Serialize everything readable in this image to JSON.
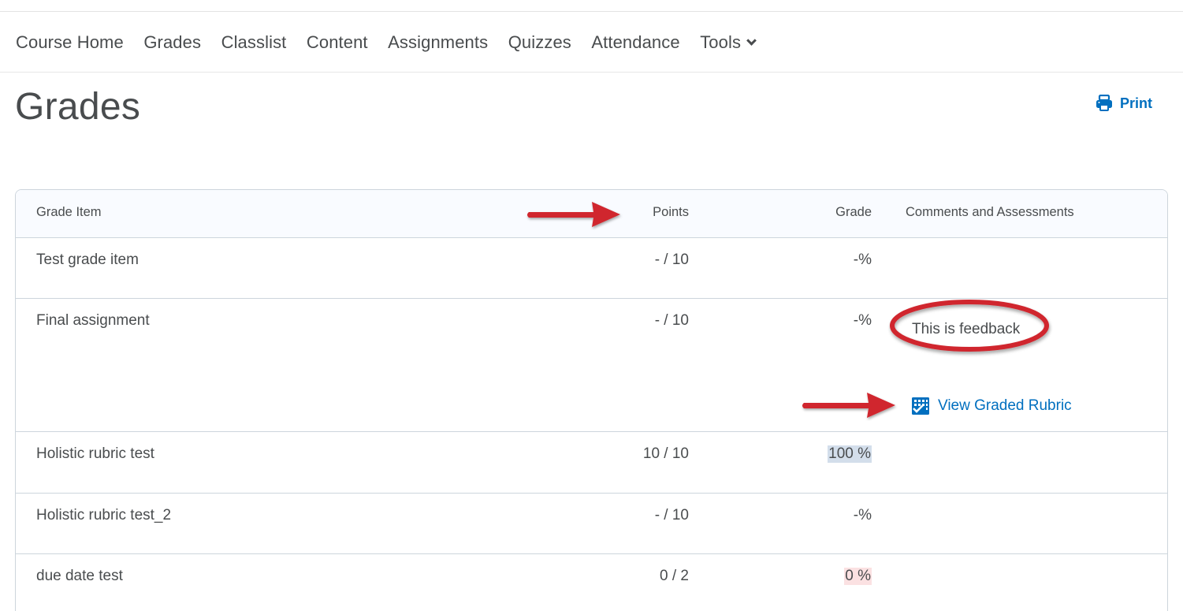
{
  "nav": {
    "items": [
      {
        "label": "Course Home"
      },
      {
        "label": "Grades"
      },
      {
        "label": "Classlist"
      },
      {
        "label": "Content"
      },
      {
        "label": "Assignments"
      },
      {
        "label": "Quizzes"
      },
      {
        "label": "Attendance"
      },
      {
        "label": "Tools",
        "has_dropdown": true,
        "icon": "chevron-down-icon"
      }
    ]
  },
  "page": {
    "title": "Grades",
    "print_label": "Print",
    "print_icon": "printer-icon"
  },
  "table": {
    "headers": {
      "item": "Grade Item",
      "points": "Points",
      "grade": "Grade",
      "comments": "Comments and Assessments"
    },
    "rows": [
      {
        "item": "Test grade item",
        "points": "- / 10",
        "grade": "-%",
        "comment": ""
      },
      {
        "item": "Final assignment",
        "points": "- / 10",
        "grade": "-%",
        "comment": "This is feedback",
        "link": "View Graded Rubric",
        "link_icon": "rubric-icon"
      },
      {
        "item": "Holistic rubric test",
        "points": "10 / 10",
        "grade": "100 %",
        "grade_highlight": "#d3deeb"
      },
      {
        "item": "Holistic rubric test_2",
        "points": "- / 10",
        "grade": "-%"
      },
      {
        "item": "due date test",
        "points": "0 / 2",
        "grade": "0 %",
        "grade_highlight": "#fbe1e2"
      }
    ]
  },
  "colors": {
    "link": "#006fbf",
    "text": "#494c4e",
    "border": "#cdd5dc",
    "header_bg": "#f9fbff",
    "annotation": "#d0262e"
  }
}
